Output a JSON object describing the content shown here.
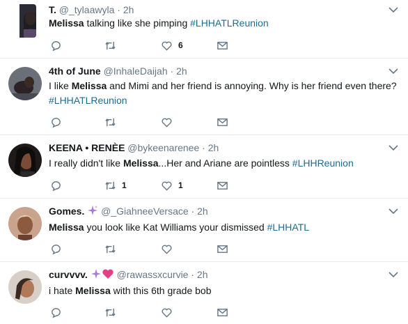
{
  "tweets": [
    {
      "name": "T.",
      "handle": "@_tylaawyla",
      "time": "2h",
      "text_parts": [
        {
          "bold": "Melissa"
        },
        {
          "plain": " talking like she pimping "
        },
        {
          "tag": "#LHHATLReunion"
        }
      ],
      "counts": {
        "reply": "",
        "retweet": "",
        "like": "6"
      },
      "colors": {
        "avatar_bg": "#2b2b35",
        "avatar_face": "#8a5a44"
      }
    },
    {
      "name": "4th of June",
      "handle": "@InhaleDaijah",
      "time": "2h",
      "text_parts": [
        {
          "plain": "I like "
        },
        {
          "bold": "Melissa"
        },
        {
          "plain": " and Mimi and her friend is annoying. Why is her friend even there?"
        },
        {
          "tag": "#LHHATLReunion"
        }
      ],
      "counts": {
        "reply": "",
        "retweet": "",
        "like": ""
      },
      "colors": {
        "avatar_bg": "#6b6f78",
        "avatar_face": "#3a2a24"
      }
    },
    {
      "name": "KEENA • RENÈE",
      "handle": "@bykeenarenee",
      "time": "2h",
      "text_parts": [
        {
          "plain": "I really didn't like "
        },
        {
          "bold": "Melissa"
        },
        {
          "plain": "...Her and Ariane are pointless "
        },
        {
          "tag": "#LHHReunion"
        }
      ],
      "counts": {
        "reply": "",
        "retweet": "1",
        "like": "1"
      },
      "colors": {
        "avatar_bg": "#1f1a1a",
        "avatar_face": "#7a4b35"
      }
    },
    {
      "name": "Gomes.",
      "handle": "@_GiahneeVersace",
      "time": "2h",
      "name_emoji": "sparkles-icon",
      "text_parts": [
        {
          "bold": "Melissa"
        },
        {
          "plain": " you look like Kat Williams your dismissed "
        },
        {
          "tag": "#LHHATL"
        }
      ],
      "counts": {
        "reply": "",
        "retweet": "",
        "like": ""
      },
      "colors": {
        "avatar_bg": "#c9a38b",
        "avatar_face": "#8c5a3e"
      }
    },
    {
      "name": "curvvvv.",
      "handle": "@rawassxcurvie",
      "time": "2h",
      "name_emoji": "sparkles-heart-icon",
      "text_parts": [
        {
          "plain": "i hate "
        },
        {
          "bold": "Melissa"
        },
        {
          "plain": " with this 6th grade bob"
        }
      ],
      "counts": {
        "reply": "",
        "retweet": "",
        "like": ""
      },
      "colors": {
        "avatar_bg": "#d9cfc9",
        "avatar_face": "#b07a5a"
      }
    }
  ],
  "colors": {
    "icon": "#657786",
    "hashtag": "#1b6c8f",
    "sparkle": "#a77bd6",
    "heart": "#e23f84",
    "divider": "#e6ecf0"
  }
}
